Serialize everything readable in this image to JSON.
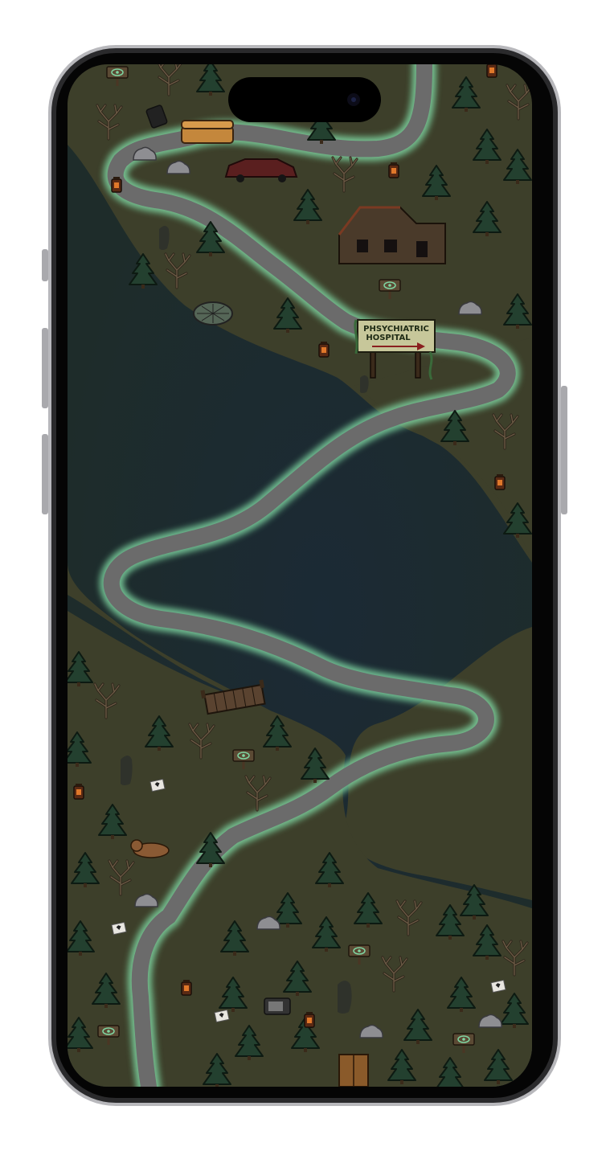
{
  "screen": {
    "type": "phone-mockup",
    "content": "horror-game-level-map"
  },
  "colors": {
    "frame": "#c9c9cc",
    "bezel": "#050505",
    "grass": "#3d3f2a",
    "water": "#1e2c2a",
    "water_deep": "#1b2a35",
    "path": "#6b6b6b",
    "path_glow": "#7fd6a2",
    "tree": "#23402f",
    "tree_outline": "#0d1a12",
    "sign_board": "#c7c79a",
    "sign_arrow": "#8a1f1f"
  },
  "hospital_sign": {
    "line1": "PHSYCHIATRIC",
    "line2": "HOSPITAL"
  },
  "level_markers": [
    {
      "name": "marker-eye",
      "icon": "eye-icon"
    },
    {
      "name": "marker-eye-2",
      "icon": "eye-icon"
    },
    {
      "name": "marker-ghost",
      "icon": "ghost-icon"
    },
    {
      "name": "marker-ghost-2",
      "icon": "ghost-icon"
    }
  ]
}
